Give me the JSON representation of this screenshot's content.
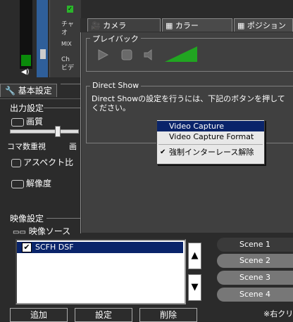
{
  "top_strip": {
    "labels": [
      "チャ",
      "オ",
      "MIX",
      "Ch",
      "ビデ"
    ]
  },
  "left_tabs": {
    "basic_settings": "基本設定"
  },
  "output_settings": {
    "title": "出力設定",
    "quality": "画質",
    "frame_rate": "コマ数重視",
    "frame_rate_right": "画",
    "aspect": "アスペクト比",
    "resolution": "解像度"
  },
  "camera_window": {
    "tabs": [
      {
        "label": "カメラ",
        "icon": "camera-icon"
      },
      {
        "label": "カラー",
        "icon": "grid-icon"
      },
      {
        "label": "ポジション",
        "icon": "grid-icon"
      }
    ],
    "playback": {
      "title": "プレイバック",
      "buttons": [
        "play-icon",
        "stop-icon",
        "speaker-icon"
      ],
      "volume_level": 1.0
    },
    "direct_show": {
      "title": "Direct Show",
      "description": "Direct Showの設定を行うには、下記のボタンを押してください。"
    }
  },
  "context_menu": {
    "items": [
      "Video Capture",
      "Video Capture Format",
      "強制インターレース解除"
    ],
    "highlighted_index": 0,
    "checked_index": 2
  },
  "video_settings": {
    "title": "映像設定",
    "source_label": "映像ソース",
    "sources": [
      {
        "name": "SCFH DSF",
        "checked": true,
        "selected": true
      }
    ],
    "add": "追加",
    "settings": "設定",
    "delete": "削除"
  },
  "scenes": [
    "Scene 1",
    "Scene 2",
    "Scene 3",
    "Scene 4"
  ],
  "footer_note": "※右クリ"
}
